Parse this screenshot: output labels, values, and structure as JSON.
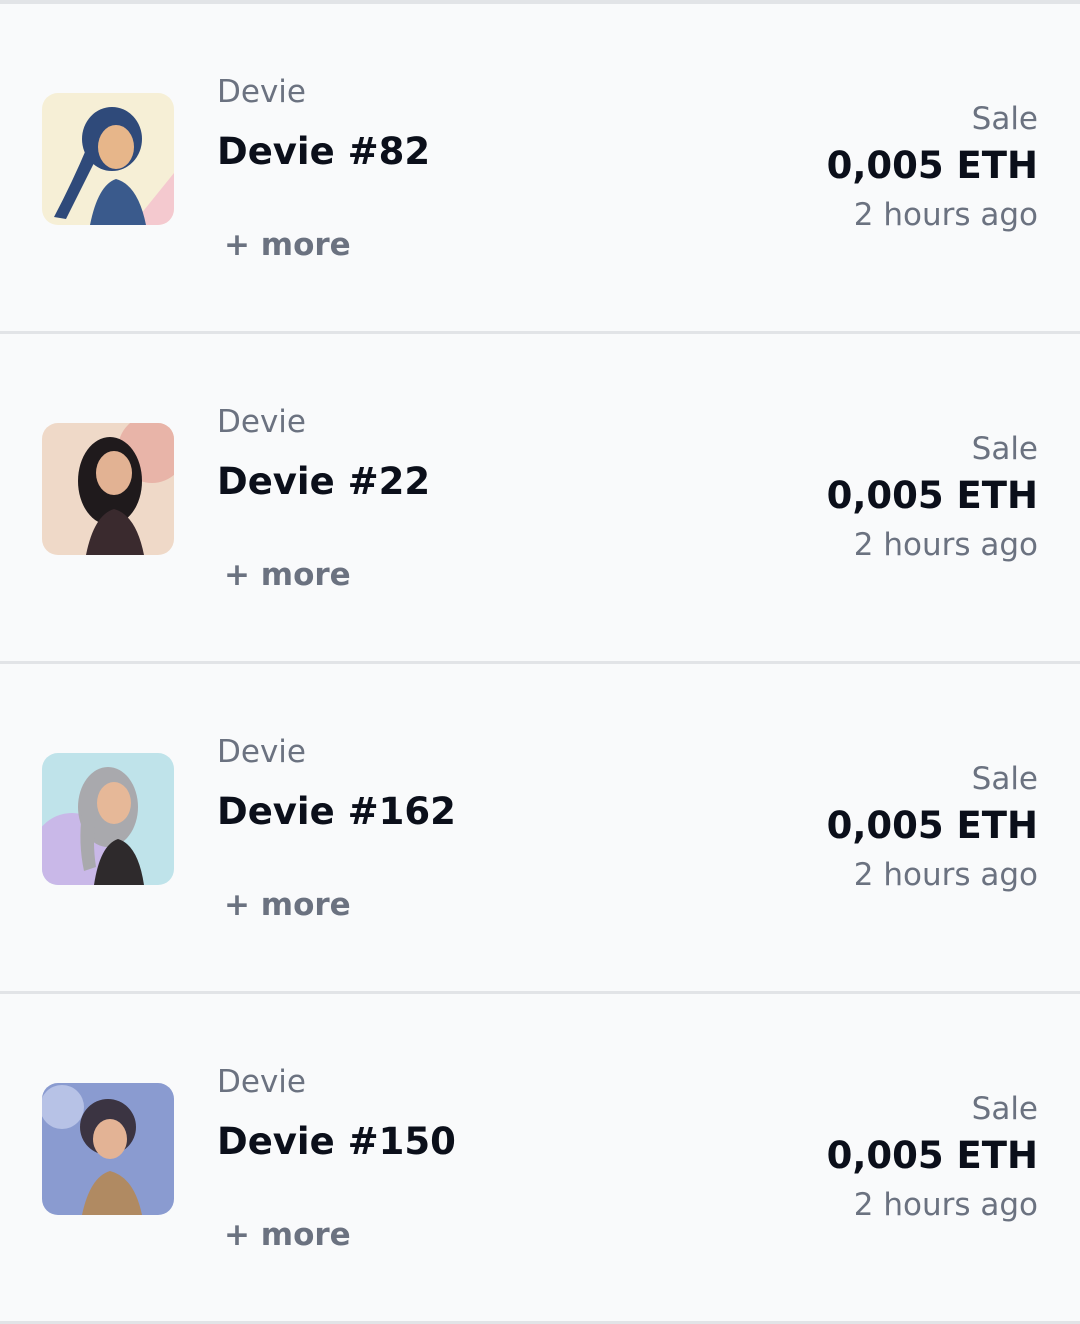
{
  "activity": [
    {
      "collection": "Devie",
      "name": "Devie #82",
      "more_label": "+ more",
      "event": "Sale",
      "price": "0,005 ETH",
      "time": "2 hours ago",
      "thumbnail": {
        "bg": "#f6efd6",
        "accent": "#f4c9cf",
        "hair": "#2f4a7a",
        "skin": "#e7b68a",
        "outfit": "#3a5a8c"
      }
    },
    {
      "collection": "Devie",
      "name": "Devie #22",
      "more_label": "+ more",
      "event": "Sale",
      "price": "0,005 ETH",
      "time": "2 hours ago",
      "thumbnail": {
        "bg": "#efd9c8",
        "accent": "#e8b4a8",
        "hair": "#1f1a1c",
        "skin": "#e2b293",
        "outfit": "#3a2a2e"
      }
    },
    {
      "collection": "Devie",
      "name": "Devie #162",
      "more_label": "+ more",
      "event": "Sale",
      "price": "0,005 ETH",
      "time": "2 hours ago",
      "thumbnail": {
        "bg": "#bfe3ea",
        "accent": "#c9b8e8",
        "hair": "#a9a9ad",
        "skin": "#e6b898",
        "outfit": "#2e2a2c"
      }
    },
    {
      "collection": "Devie",
      "name": "Devie #150",
      "more_label": "+ more",
      "event": "Sale",
      "price": "0,005 ETH",
      "time": "2 hours ago",
      "thumbnail": {
        "bg": "#8a9bd0",
        "accent": "#b7c2e6",
        "hair": "#3b3442",
        "skin": "#e3b395",
        "outfit": "#b08a62"
      }
    }
  ]
}
